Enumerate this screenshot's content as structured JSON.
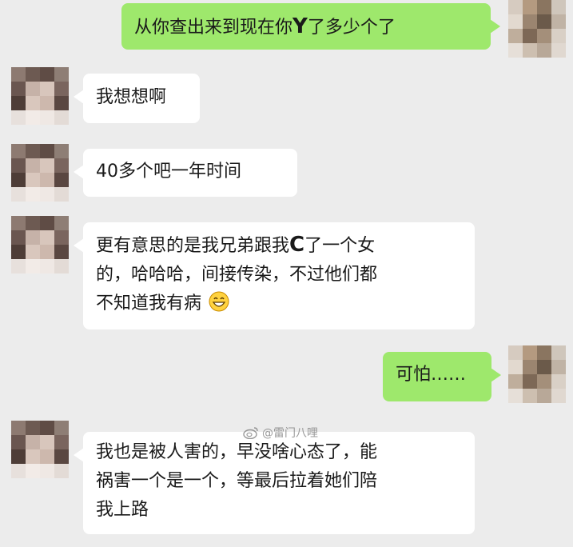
{
  "messages": [
    {
      "direction": "out",
      "parts": [
        "从你查出来到现在你",
        "Y",
        "了多少个了"
      ]
    },
    {
      "direction": "in",
      "lines": [
        "我想想啊"
      ]
    },
    {
      "direction": "in",
      "lines": [
        "40多个吧一年时间"
      ]
    },
    {
      "direction": "in",
      "line1": [
        "更有意思的是我兄弟跟我",
        "C",
        "了一个女"
      ],
      "line2": "的，哈哈哈，间接传染，不过他们都",
      "line3": "不知道我有病",
      "emoji": "grinning-face-emoji"
    },
    {
      "direction": "out",
      "lines": [
        "可怕……"
      ]
    },
    {
      "direction": "in",
      "lines": [
        "我也是被人害的，早没啥心态了，能",
        "祸害一个是一个，等最后拉着她们陪",
        "我上路"
      ]
    }
  ],
  "watermark": {
    "icon": "weibo-icon",
    "text": "@雷门八哩"
  },
  "colors": {
    "background": "#ececec",
    "incoming_bubble": "#ffffff",
    "outgoing_bubble": "#9ee86c"
  }
}
